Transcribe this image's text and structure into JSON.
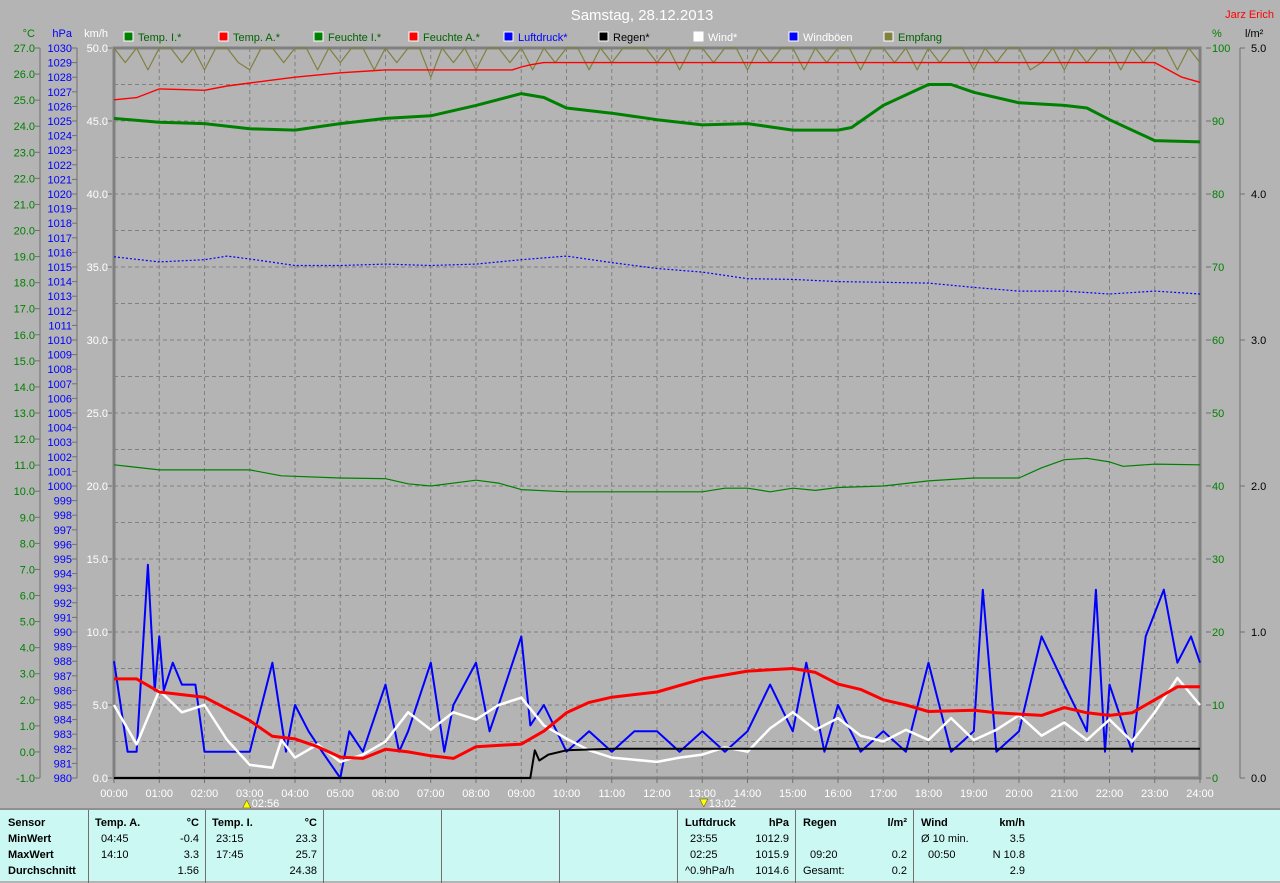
{
  "header": {
    "title": "Samstag, 28.12.2013",
    "author": "Jarz Erich"
  },
  "legend": [
    {
      "label": "Temp. I.*",
      "box": "#008000",
      "text": "#006400"
    },
    {
      "label": "Temp. A.*",
      "box": "#ff0000",
      "text": "#006400"
    },
    {
      "label": "Feuchte I.*",
      "box": "#008000",
      "text": "#006400"
    },
    {
      "label": "Feuchte A.*",
      "box": "#ff0000",
      "text": "#006400"
    },
    {
      "label": "Luftdruck*",
      "box": "#0000ff",
      "text": "#0000ff"
    },
    {
      "label": "Regen*",
      "box": "#000000",
      "text": "#000000"
    },
    {
      "label": "Wind*",
      "box": "#ffffff",
      "text": "#ffffff"
    },
    {
      "label": "Windböen",
      "box": "#0000ff",
      "text": "#ffffff"
    },
    {
      "label": "Empfang",
      "box": "#808040",
      "text": "#006400"
    }
  ],
  "markers": [
    {
      "label": "02:56",
      "hour": 2.933,
      "dir": "up"
    },
    {
      "label": "13:02",
      "hour": 13.033,
      "dir": "down"
    }
  ],
  "chart_data": {
    "type": "line",
    "title": "Samstag, 28.12.2013",
    "grid": true,
    "x_ticks": [
      "00:00",
      "01:00",
      "02:00",
      "03:00",
      "04:00",
      "05:00",
      "06:00",
      "07:00",
      "08:00",
      "09:00",
      "10:00",
      "11:00",
      "12:00",
      "13:00",
      "14:00",
      "15:00",
      "16:00",
      "17:00",
      "18:00",
      "19:00",
      "20:00",
      "21:00",
      "22:00",
      "23:00",
      "24:00"
    ],
    "axes": {
      "temp": {
        "unit": "°C",
        "range": [
          -1,
          27
        ],
        "step": 1,
        "color": "#008000",
        "decimals": 1
      },
      "press": {
        "unit": "hPa",
        "range": [
          980,
          1030
        ],
        "step": 1,
        "color": "#0000ff",
        "decimals": 0
      },
      "wind": {
        "unit": "km/h",
        "range": [
          0,
          50
        ],
        "step": 5,
        "color": "#ffffff",
        "decimals": 1
      },
      "hum": {
        "unit": "%",
        "range": [
          0,
          100
        ],
        "step": 10,
        "color": "#008000",
        "decimals": 0
      },
      "rain": {
        "unit": "l/m²",
        "range": [
          0,
          5
        ],
        "step": 1,
        "color": "#000000",
        "decimals": 1
      }
    },
    "series": [
      {
        "name": "Empfang",
        "axis": "hum",
        "color": "#808040",
        "width": 1.2,
        "x_step": 0.25,
        "values": [
          100,
          98,
          100,
          97,
          100,
          100,
          98,
          100,
          97,
          100,
          100,
          98,
          97,
          100,
          100,
          98,
          100,
          100,
          97,
          100,
          98,
          100,
          100,
          97,
          100,
          98,
          100,
          100,
          96,
          100,
          98,
          100,
          97,
          100,
          100,
          98,
          100,
          97,
          100,
          98,
          100,
          100,
          97,
          100,
          98,
          100,
          100,
          100,
          98,
          100,
          97,
          100,
          100,
          98,
          100,
          100,
          97,
          100,
          98,
          100,
          100,
          97,
          100,
          98,
          100,
          100,
          97,
          100,
          100,
          98,
          100,
          97,
          100,
          98,
          100,
          100,
          97,
          100,
          98,
          100,
          100,
          97,
          98,
          100,
          97,
          100,
          98,
          100,
          100,
          97,
          100,
          98,
          100,
          100,
          97,
          100,
          98
        ]
      },
      {
        "name": "Feuchte A.",
        "axis": "hum",
        "color": "#ff0000",
        "width": 1.4,
        "x": [
          0,
          0.5,
          1,
          1.5,
          2,
          2.5,
          3,
          3.5,
          4,
          5,
          6,
          7,
          8,
          8.8,
          9.0,
          9.2,
          9.5,
          23.0,
          23.3,
          23.6,
          24
        ],
        "values": [
          92.9,
          93.2,
          94.4,
          94.3,
          94.2,
          94.8,
          95.2,
          95.6,
          96.0,
          96.6,
          97.0,
          97.0,
          97.0,
          97.0,
          97.4,
          97.7,
          98.0,
          98.0,
          97.0,
          96.0,
          95.3
        ]
      },
      {
        "name": "Temp. I.",
        "axis": "temp",
        "color": "#008000",
        "width": 3,
        "x": [
          0,
          1,
          2,
          3,
          4,
          5,
          6,
          7,
          8,
          9,
          9.5,
          10,
          11,
          12,
          13,
          14,
          15,
          16,
          16.3,
          17,
          18,
          18.5,
          19,
          20,
          21,
          21.5,
          22,
          23,
          24
        ],
        "values": [
          24.3,
          24.15,
          24.1,
          23.9,
          23.85,
          24.1,
          24.3,
          24.4,
          24.8,
          25.25,
          25.1,
          24.7,
          24.5,
          24.25,
          24.05,
          24.1,
          23.85,
          23.85,
          23.95,
          24.8,
          25.6,
          25.6,
          25.3,
          24.9,
          24.8,
          24.7,
          24.25,
          23.45,
          23.4
        ]
      },
      {
        "name": "Luftdruck",
        "axis": "press",
        "color": "#0000ff",
        "width": 1.2,
        "dash": "2,2",
        "x": [
          0,
          1,
          2,
          2.5,
          3,
          4,
          5,
          6,
          7,
          8,
          9,
          10,
          11,
          12,
          13,
          14,
          15,
          16,
          17,
          18,
          19,
          20,
          21,
          22,
          23,
          24
        ],
        "values": [
          1015.7,
          1015.35,
          1015.5,
          1015.75,
          1015.55,
          1015.1,
          1015.1,
          1015.2,
          1015.1,
          1015.2,
          1015.5,
          1015.75,
          1015.3,
          1014.9,
          1014.65,
          1014.2,
          1014.15,
          1014.0,
          1013.95,
          1013.9,
          1013.6,
          1013.35,
          1013.35,
          1013.15,
          1013.35,
          1013.15
        ]
      },
      {
        "name": "Feuchte I.",
        "axis": "hum",
        "color": "#008000",
        "width": 1.2,
        "x": [
          0,
          1,
          3,
          3.7,
          5,
          6,
          6.5,
          7,
          8,
          8.5,
          9,
          10,
          13,
          13.5,
          14,
          14.5,
          15,
          15.5,
          16,
          17,
          18,
          19,
          20,
          20.5,
          21,
          21.5,
          22,
          22.3,
          23,
          24
        ],
        "values": [
          42.9,
          42.2,
          42.2,
          41.4,
          41.1,
          41.0,
          40.3,
          40.0,
          40.8,
          40.4,
          39.5,
          39.2,
          39.2,
          39.7,
          39.7,
          39.2,
          39.7,
          39.4,
          39.8,
          40.0,
          40.7,
          41.1,
          41.1,
          42.5,
          43.6,
          43.8,
          43.3,
          42.7,
          43.0,
          42.9
        ]
      },
      {
        "name": "Windböen",
        "axis": "wind",
        "color": "#0000ff",
        "width": 2,
        "x": [
          0,
          0.3,
          0.5,
          0.75,
          0.9,
          1.0,
          1.1,
          1.3,
          1.5,
          1.8,
          2.0,
          2.2,
          2.6,
          3.0,
          3.5,
          3.8,
          4.0,
          4.3,
          4.6,
          5.0,
          5.2,
          5.5,
          6.0,
          6.3,
          6.5,
          7.0,
          7.3,
          7.5,
          8.0,
          8.3,
          8.5,
          9.0,
          9.2,
          9.5,
          10.0,
          10.5,
          11.0,
          11.5,
          12.0,
          12.5,
          13.0,
          13.5,
          14.0,
          14.5,
          15.0,
          15.3,
          15.7,
          16.0,
          16.5,
          17.0,
          17.5,
          18.0,
          18.5,
          19.0,
          19.2,
          19.5,
          20.0,
          20.5,
          21.0,
          21.5,
          21.7,
          21.9,
          22.0,
          22.5,
          22.8,
          23.2,
          23.5,
          23.8,
          24.0
        ],
        "values": [
          8.0,
          1.8,
          1.8,
          14.6,
          6.0,
          9.7,
          6.0,
          7.9,
          6.4,
          6.4,
          1.8,
          1.8,
          1.8,
          1.8,
          7.9,
          1.8,
          5.0,
          3.2,
          1.8,
          0,
          3.2,
          1.8,
          6.4,
          1.8,
          3.2,
          7.9,
          1.8,
          5.0,
          7.9,
          3.2,
          5.0,
          9.7,
          3.6,
          5.0,
          1.8,
          3.2,
          1.8,
          3.2,
          3.2,
          1.8,
          3.2,
          1.8,
          3.2,
          6.4,
          3.2,
          7.9,
          1.8,
          5.0,
          1.8,
          3.2,
          1.8,
          7.9,
          1.8,
          3.2,
          12.9,
          1.8,
          3.2,
          9.7,
          6.4,
          3.2,
          12.9,
          1.8,
          6.4,
          1.8,
          9.7,
          12.9,
          7.9,
          9.7,
          7.9
        ]
      },
      {
        "name": "Wind",
        "axis": "wind",
        "color": "#ffffff",
        "width": 2.5,
        "x": [
          0,
          0.5,
          1,
          1.5,
          2,
          2.5,
          3,
          3.5,
          3.7,
          4,
          4.5,
          5,
          5.5,
          6,
          6.5,
          7,
          7.5,
          8,
          8.5,
          9,
          9.5,
          10,
          10.5,
          11,
          12,
          12.5,
          13,
          13.5,
          14,
          14.5,
          15,
          15.5,
          16,
          16.5,
          17,
          17.5,
          18,
          18.5,
          19,
          19.5,
          20,
          20.5,
          21,
          21.5,
          22,
          22.5,
          23,
          23.5,
          24
        ],
        "values": [
          5.0,
          2.3,
          6.0,
          4.5,
          5.0,
          2.6,
          0.9,
          0.7,
          2.6,
          1.4,
          2.3,
          1.1,
          1.6,
          2.5,
          4.5,
          3.3,
          4.5,
          4.0,
          5.0,
          5.5,
          3.6,
          2.7,
          1.9,
          1.4,
          1.1,
          1.4,
          1.6,
          2.1,
          1.8,
          3.4,
          4.5,
          3.3,
          4.1,
          2.9,
          2.5,
          3.3,
          2.6,
          4.1,
          2.6,
          3.3,
          4.3,
          2.9,
          3.8,
          2.6,
          4.0,
          2.5,
          4.5,
          6.85,
          5.0
        ]
      },
      {
        "name": "Temp. A.",
        "axis": "temp",
        "color": "#ff0000",
        "width": 3,
        "x": [
          0,
          0.5,
          1,
          2,
          3,
          3.5,
          4,
          4.5,
          5,
          5.5,
          6,
          6.5,
          7,
          7.5,
          8,
          9,
          9.5,
          10,
          10.5,
          11,
          12,
          13,
          14,
          15,
          15.5,
          16,
          16.5,
          17,
          17.5,
          18,
          19,
          19.5,
          20,
          20.5,
          21,
          21.5,
          22,
          22.5,
          23,
          23.5,
          24
        ],
        "values": [
          2.8,
          2.8,
          2.3,
          2.1,
          1.2,
          0.6,
          0.5,
          0.2,
          -0.2,
          -0.25,
          0.1,
          0.0,
          -0.15,
          -0.25,
          0.2,
          0.3,
          0.8,
          1.5,
          1.9,
          2.1,
          2.3,
          2.8,
          3.1,
          3.2,
          3.05,
          2.6,
          2.4,
          2.0,
          1.8,
          1.55,
          1.6,
          1.5,
          1.45,
          1.4,
          1.7,
          1.5,
          1.4,
          1.5,
          2.0,
          2.5,
          2.5
        ]
      },
      {
        "name": "Regen",
        "axis": "rain",
        "color": "#000000",
        "width": 2,
        "x": [
          0,
          9.2,
          9.3,
          9.4,
          9.6,
          10,
          11,
          24
        ],
        "values": [
          0,
          0,
          0.19,
          0.12,
          0.16,
          0.19,
          0.2,
          0.2
        ]
      }
    ]
  },
  "summary": {
    "sensor_col": {
      "header": "Sensor",
      "rows": [
        "MinWert",
        "MaxWert",
        "Durchschnitt"
      ]
    },
    "temp_a": {
      "header": "Temp. A.",
      "unit": "°C",
      "min_time": "04:45",
      "min": "-0.4",
      "max_time": "14:10",
      "max": "3.3",
      "avg": "1.56"
    },
    "temp_i": {
      "header": "Temp. I.",
      "unit": "°C",
      "min_time": "23:15",
      "min": "23.3",
      "max_time": "17:45",
      "max": "25.7",
      "avg": "24.38"
    },
    "pressure": {
      "header": "Luftdruck",
      "unit": "hPa",
      "min_time": "23:55",
      "min": "1012.9",
      "max_time": "02:25",
      "max": "1015.9",
      "trend": "^0.9hPa/h",
      "avg": "1014.6"
    },
    "rain": {
      "header": "Regen",
      "unit": "l/m²",
      "max_time": "09:20",
      "max": "0.2",
      "total_label": "Gesamt:",
      "total": "0.2"
    },
    "wind": {
      "header": "Wind",
      "unit": "km/h",
      "avg_label": "Ø 10 min.",
      "avg10": "3.5",
      "max_time": "00:50",
      "max": "N 10.8",
      "avg": "2.9"
    }
  }
}
